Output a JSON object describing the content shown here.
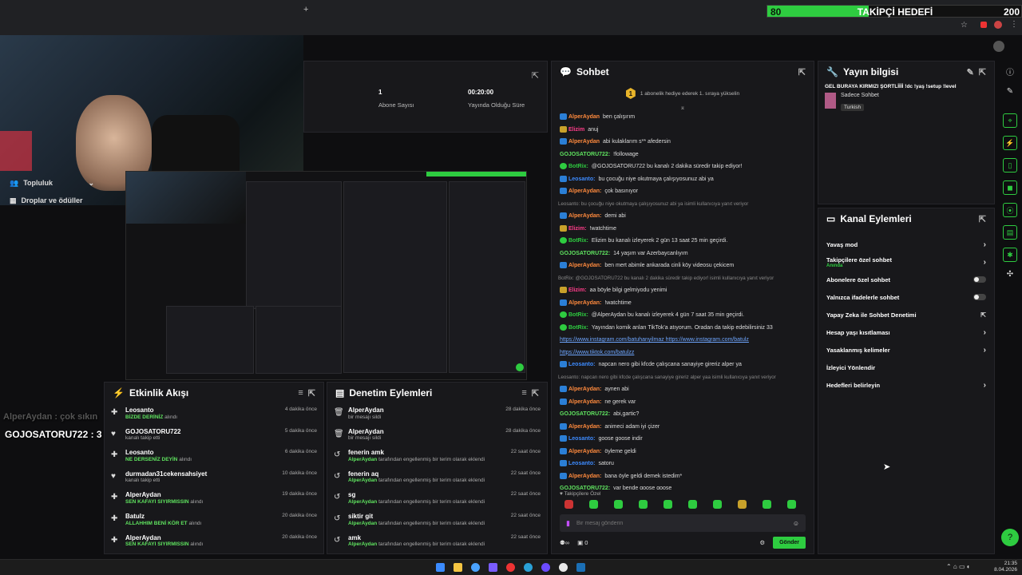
{
  "goal": {
    "title": "TAKİPÇİ HEDEFİ",
    "current": "80",
    "target": "200",
    "progress": 0.4,
    "color": "#2ecc40"
  },
  "sidebar": {
    "items": [
      {
        "label": "Topluluk",
        "icon": "people-icon"
      },
      {
        "label": "Droplar ve ödüller",
        "icon": "gift-icon"
      }
    ]
  },
  "stats": {
    "subscribers_value": "1",
    "subscribers_label": "Abone Sayısı",
    "stream_time_value": "00:20:00",
    "stream_time_label": "Yayında Olduğu Süre"
  },
  "overlay": {
    "faded_line": "AlperAydan : çok sıkın",
    "chat_line": "GOJOSATORU722 : 3 milyon az mış"
  },
  "activity": {
    "title": "Etkinlik Akışı",
    "items": [
      {
        "user": "Leosanto",
        "detail_hl": "BİZDE DERİNİZ",
        "detail": "alındı",
        "time": "4 dakika önce",
        "icon": "gift-icon"
      },
      {
        "user": "GOJOSATORU722",
        "detail_hl": "",
        "detail": "kanalı takip etti",
        "time": "5 dakika önce",
        "icon": "heart-icon"
      },
      {
        "user": "Leosanto",
        "detail_hl": "NE DERSENİZ DEYİN",
        "detail": "alındı",
        "time": "6 dakika önce",
        "icon": "gift-icon"
      },
      {
        "user": "durmadan31cekensahsiyet",
        "detail_hl": "",
        "detail": "kanalı takip etti",
        "time": "10 dakika önce",
        "icon": "heart-icon"
      },
      {
        "user": "AlperAydan",
        "detail_hl": "SEN KAFAYI SIYIRMISSIN",
        "detail": "alındı",
        "time": "19 dakika önce",
        "icon": "gift-icon"
      },
      {
        "user": "Batulz",
        "detail_hl": "ALLAHHIM BENİ KÖR ET",
        "detail": "alındı",
        "time": "20 dakika önce",
        "icon": "gift-icon"
      },
      {
        "user": "AlperAydan",
        "detail_hl": "SEN KAFAYI SIYIRMISSIN",
        "detail": "alındı",
        "time": "20 dakika önce",
        "icon": "gift-icon"
      }
    ]
  },
  "moderation": {
    "title": "Denetim Eylemleri",
    "items": [
      {
        "user": "AlperAydan",
        "detail_hl": "",
        "detail": "bir mesajı sildi",
        "time": "28 dakika önce",
        "icon": "trash-icon"
      },
      {
        "user": "AlperAydan",
        "detail_hl": "",
        "detail": "bir mesajı sildi",
        "time": "28 dakika önce",
        "icon": "trash-icon"
      },
      {
        "user": "fenerin amk",
        "detail_hl": "AlperAydan",
        "detail": "tarafından engellenmiş bir terim olarak eklendi",
        "time": "22 saat önce",
        "icon": "undo-icon"
      },
      {
        "user": "fenerin aq",
        "detail_hl": "AlperAydan",
        "detail": "tarafından engellenmiş bir terim olarak eklendi",
        "time": "22 saat önce",
        "icon": "undo-icon"
      },
      {
        "user": "sg",
        "detail_hl": "AlperAydan",
        "detail": "tarafından engellenmiş bir terim olarak eklendi",
        "time": "22 saat önce",
        "icon": "undo-icon"
      },
      {
        "user": "siktir git",
        "detail_hl": "AlperAydan",
        "detail": "tarafından engellenmiş bir terim olarak eklendi",
        "time": "22 saat önce",
        "icon": "undo-icon"
      },
      {
        "user": "amk",
        "detail_hl": "AlperAydan",
        "detail": "tarafından engellenmiş bir terim olarak eklendi",
        "time": "22 saat önce",
        "icon": "undo-icon"
      }
    ]
  },
  "chat": {
    "title": "Sohbet",
    "pinned": "1 abonelik hediye ederek 1. sıraya yükselin",
    "pinned_count": "1",
    "messages": [
      {
        "user": "AlperAydan",
        "cls": "alper",
        "badge": "",
        "text": "ben çalışırım"
      },
      {
        "user": "Elizim",
        "cls": "eliz",
        "badge": "k",
        "text": "anuj"
      },
      {
        "user": "AlperAydan",
        "cls": "alper",
        "badge": "",
        "text": "abi kulaklarım s** afedersin"
      },
      {
        "user": "GOJOSATORU722:",
        "cls": "gojo",
        "badge": "none",
        "text": "!followage"
      },
      {
        "user": "BotRix:",
        "cls": "bot",
        "badge": "g",
        "text": "@GOJOSATORU722 bu kanalı 2 dakika süredir takip ediyor!"
      },
      {
        "user": "Leosanto:",
        "cls": "leo",
        "badge": "",
        "text": "bu çocuğu niye okutmaya çalışıyosunuz abi ya"
      },
      {
        "user": "AlperAydan:",
        "cls": "alper",
        "badge": "",
        "text": "çok basınıyor"
      },
      {
        "user": "",
        "cls": "sys",
        "badge": "none",
        "text": "Leosanto: bu çocuğu niye okutmaya çalışıyosunuz abi ya isimli kullanıcıya yanıt veriyor"
      },
      {
        "user": "AlperAydan:",
        "cls": "alper",
        "badge": "",
        "text": "demi abi"
      },
      {
        "user": "Elizim:",
        "cls": "eliz",
        "badge": "k",
        "text": "!watchtime"
      },
      {
        "user": "BotRix:",
        "cls": "bot",
        "badge": "g",
        "text": "Elizim bu kanalı izleyerek 2 gün 13 saat 25 min geçirdi."
      },
      {
        "user": "GOJOSATORU722:",
        "cls": "gojo",
        "badge": "none",
        "text": "14 yaşım var Azerbaycanlıyım"
      },
      {
        "user": "AlperAydan:",
        "cls": "alper",
        "badge": "",
        "text": "ben mert abimle ankarada cinli köy videosu çekicem"
      },
      {
        "user": "",
        "cls": "sys",
        "badge": "none",
        "text": "BotRix: @GOJOSATORU722 bu kanalı 2 dakika süredir takip ediyor! isimli kullanıcıya yanıt veriyor"
      },
      {
        "user": "Elizim:",
        "cls": "eliz",
        "badge": "k",
        "text": "aa böyle bilgi gelmiyodu yenimi"
      },
      {
        "user": "AlperAydan:",
        "cls": "alper",
        "badge": "",
        "text": "!watchtime"
      },
      {
        "user": "BotRix:",
        "cls": "bot",
        "badge": "g",
        "text": "@AlperAydan bu kanalı izleyerek 4 gün 7 saat 35 min geçirdi."
      },
      {
        "user": "BotRix:",
        "cls": "bot",
        "badge": "g",
        "text": "Yayından komik anları TikTok'a atıyorum. Oradan da takip edebilirsiniz 33"
      },
      {
        "user": "",
        "cls": "link",
        "badge": "none",
        "text": "https://www.instagram.com/batuhanyilmaz https://www.instagram.com/batulz"
      },
      {
        "user": "",
        "cls": "link",
        "badge": "none",
        "text": "https://www.tiktok.com/batulzz"
      },
      {
        "user": "Leosanto:",
        "cls": "leo",
        "badge": "",
        "text": "napcan nero gibi kfcde çalışcana sanayiye gireriz alper ya"
      },
      {
        "user": "",
        "cls": "sys",
        "badge": "none",
        "text": "Leosanto: napcan nero gibi kfcde çalışcana sanayiye gireriz alper yaa isimli kullanıcıya yanıt veriyor"
      },
      {
        "user": "AlperAydan:",
        "cls": "alper",
        "badge": "",
        "text": "aynen abi"
      },
      {
        "user": "AlperAydan:",
        "cls": "alper",
        "badge": "",
        "text": "ne gerek var"
      },
      {
        "user": "GOJOSATORU722:",
        "cls": "gojo",
        "badge": "none",
        "text": "abi,gartic?"
      },
      {
        "user": "AlperAydan:",
        "cls": "alper",
        "badge": "",
        "text": "animeci adam iyi çizer"
      },
      {
        "user": "Leosanto:",
        "cls": "leo",
        "badge": "",
        "text": "goose goose indir"
      },
      {
        "user": "AlperAydan:",
        "cls": "alper",
        "badge": "",
        "text": "öyleme geldi"
      },
      {
        "user": "Leosanto:",
        "cls": "leo",
        "badge": "",
        "text": "satoru"
      },
      {
        "user": "AlperAydan:",
        "cls": "alper",
        "badge": "",
        "text": "bana öyle geldi demek istedim*"
      },
      {
        "user": "GOJOSATORU722:",
        "cls": "gojo",
        "badge": "none",
        "text": "var bende goose goose"
      },
      {
        "user": "AlperAydan:",
        "cls": "alper",
        "badge": "",
        "text": "çok sıkıntı o işler"
      },
      {
        "user": "GOJOSATORU722:",
        "cls": "gojo",
        "badge": "none",
        "text": "3 milyon az mış"
      }
    ],
    "followers_only": "Takipçilere Özel",
    "input_placeholder": "Bir mesaj gönderin",
    "send_label": "Gönder",
    "counter_value": "0",
    "infinity": "∞"
  },
  "stream_info": {
    "title": "Yayın bilgisi",
    "stream_title": "GEL BURAYA KIRMIZI ŞORTLİİİİ !dc !yaş !setup !level",
    "category": "Sadece Sohbet",
    "tag": "Turkish"
  },
  "channel_actions": {
    "title": "Kanal Eylemleri",
    "items": [
      {
        "label": "Yavaş mod",
        "sub": "",
        "control": "chevron"
      },
      {
        "label": "Takipçilere özel sohbet",
        "sub": "Anında",
        "control": "chevron"
      },
      {
        "label": "Abonelere özel sohbet",
        "sub": "",
        "control": "toggle"
      },
      {
        "label": "Yalnızca ifadelerle sohbet",
        "sub": "",
        "control": "toggle"
      },
      {
        "label": "Yapay Zeka ile Sohbet Denetimi",
        "sub": "",
        "control": "external"
      },
      {
        "label": "Hesap yaşı kısıtlaması",
        "sub": "",
        "control": "chevron"
      },
      {
        "label": "Yasaklanmış kelimeler",
        "sub": "",
        "control": "chevron"
      },
      {
        "label": "İzleyici Yönlendir",
        "sub": "",
        "control": "none"
      },
      {
        "label": "Hedefleri belirleyin",
        "sub": "",
        "control": "chevron"
      }
    ]
  },
  "system_tray": {
    "time": "21:35",
    "date": "8.04.2026"
  }
}
